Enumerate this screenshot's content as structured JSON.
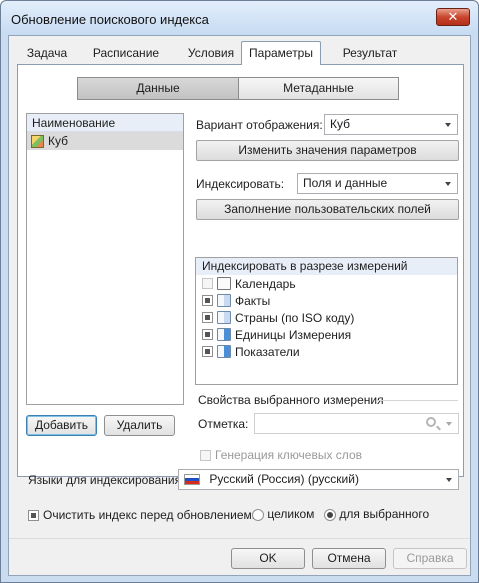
{
  "window": {
    "title": "Обновление поискового индекса",
    "close_glyph": "✕"
  },
  "tabs": [
    {
      "label": "Задача"
    },
    {
      "label": "Расписание"
    },
    {
      "label": "Условия"
    },
    {
      "label": "Параметры",
      "active": true
    },
    {
      "label": "Результат"
    }
  ],
  "segmented": {
    "data_label": "Данные",
    "metadata_label": "Метаданные",
    "selected": "Данные"
  },
  "list": {
    "header": "Наименование",
    "items": [
      {
        "label": "Куб",
        "icon": "cube-icon"
      }
    ]
  },
  "buttons": {
    "add": "Добавить",
    "delete": "Удалить",
    "change_params": "Изменить значения параметров",
    "fill_user_fields": "Заполнение пользовательских полей",
    "ok": "OK",
    "cancel": "Отмена",
    "help": "Справка"
  },
  "display": {
    "label": "Вариант отображения:",
    "value": "Куб"
  },
  "indexing": {
    "label": "Индексировать:",
    "value": "Поля и данные"
  },
  "dimensions": {
    "header": "Индексировать в разрезе измерений",
    "items": [
      {
        "label": "Календарь",
        "state": "unchecked",
        "icon": "calendar-icon"
      },
      {
        "label": "Факты",
        "state": "partial",
        "icon": "dictionary-icon"
      },
      {
        "label": "Страны (по ISO коду)",
        "state": "partial",
        "icon": "dictionary-icon"
      },
      {
        "label": "Единицы Измерения",
        "state": "partial",
        "icon": "dictionary-icon"
      },
      {
        "label": "Показатели",
        "state": "partial",
        "icon": "dictionary-icon"
      }
    ]
  },
  "properties": {
    "title": "Свойства выбранного измерения",
    "mark_label": "Отметка:",
    "mark_value": "",
    "keyword_generation": "Генерация ключевых слов",
    "keyword_generation_checked": false
  },
  "languages": {
    "label": "Языки для индексирования:",
    "value": "Русский (Россия) (русский)"
  },
  "clear_index": {
    "label": "Очистить индекс перед обновлением:",
    "checked": false,
    "option_entire": "целиком",
    "option_selected": "для выбранного",
    "selected_option": "для выбранного"
  }
}
